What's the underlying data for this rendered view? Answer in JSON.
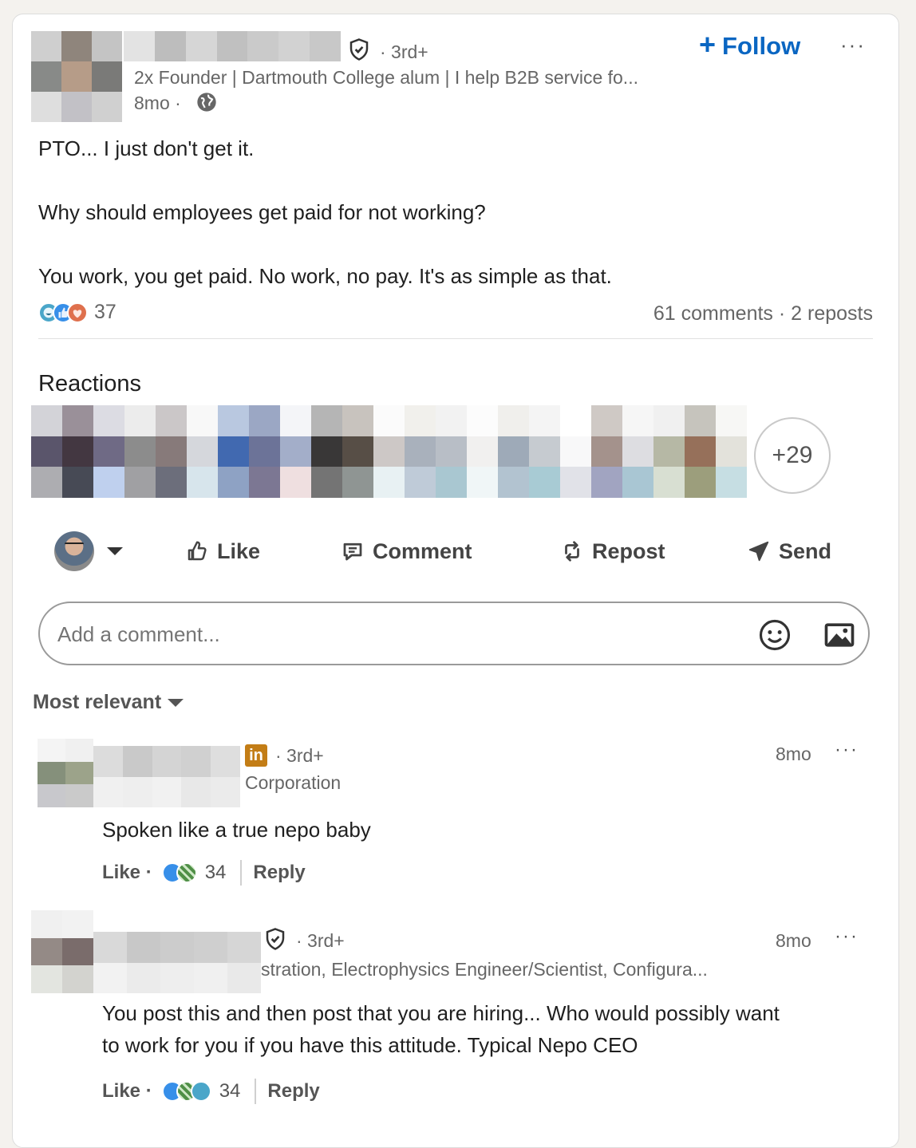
{
  "post": {
    "author_degree": "· 3rd+",
    "author_headline": "2x Founder | Dartmouth College alum | I help B2B service fo...",
    "time": "8mo ·",
    "follow_label": "Follow",
    "body_lines": [
      "PTO... I just don't get it.",
      "Why should employees get paid for not working?",
      "You work, you get paid. No work, no pay. It's as simple as that."
    ],
    "reaction_count": "37",
    "comments_reposts": "61 comments · 2 reposts"
  },
  "reactions": {
    "heading": "Reactions",
    "more_count": "+29"
  },
  "actions": {
    "like": "Like",
    "comment": "Comment",
    "repost": "Repost",
    "send": "Send"
  },
  "composer": {
    "placeholder": "Add a comment..."
  },
  "sort": {
    "label": "Most relevant"
  },
  "comments": [
    {
      "badge": "in",
      "degree": "· 3rd+",
      "subtitle": "Corporation",
      "time": "8mo",
      "text_lines": [
        "Spoken like a true nepo baby"
      ],
      "like_label": "Like ·",
      "reaction_count": "34",
      "reply_label": "Reply"
    },
    {
      "degree": "· 3rd+",
      "subtitle": "stration, Electrophysics Engineer/Scientist, Configura...",
      "time": "8mo",
      "text_lines": [
        "You post this and then post that you are hiring... Who would possibly want",
        "to work for you if you have this attitude. Typical Nepo CEO"
      ],
      "like_label": "Like ·",
      "reaction_count": "34",
      "reply_label": "Reply"
    }
  ],
  "colors": {
    "accent": "#0a66c2",
    "linkedin_gold": "#c37d16",
    "border": "#dcdcdc",
    "background": "#f4f2ee"
  },
  "icons": [
    "verified-shield-icon",
    "globe-icon",
    "plus-icon",
    "more-icon",
    "like-icon",
    "comment-icon",
    "repost-icon",
    "send-icon",
    "emoji-icon",
    "image-icon",
    "caret-down-icon"
  ]
}
